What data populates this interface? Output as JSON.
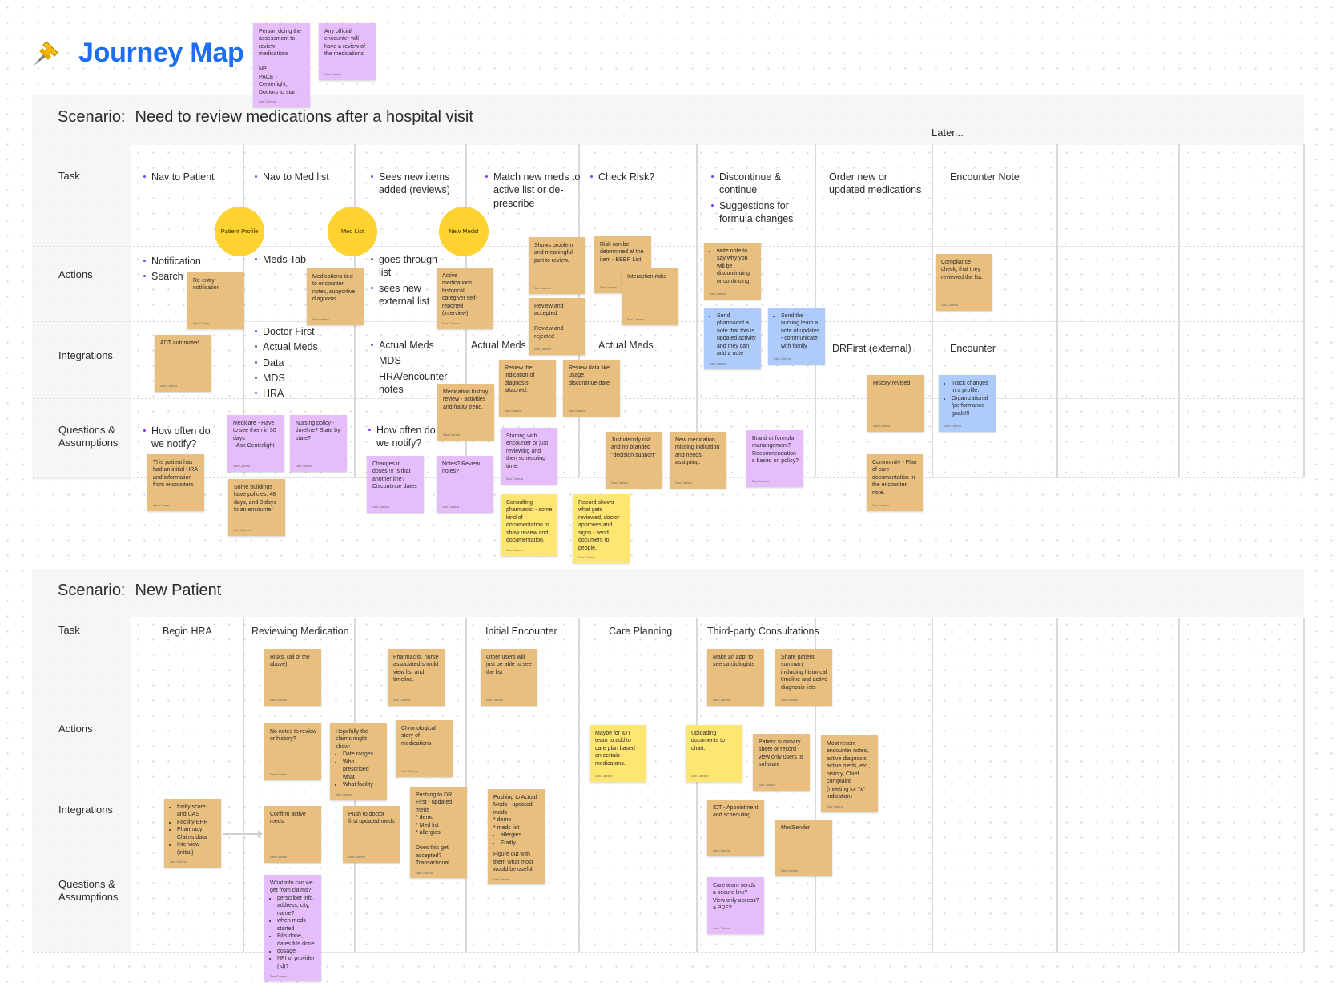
{
  "header": {
    "title": "Journey Map",
    "icon": "pushpin-icon",
    "notes": [
      {
        "color": "violet",
        "text": "Person doing the assessment to review medications\n\nNP\nPACE - Centerlight, Doctors to start",
        "author": "Sam Cabrera"
      },
      {
        "color": "violet",
        "text": "Any official encounter will have a review of the medications",
        "author": "Sam Cabrera"
      }
    ]
  },
  "row_labels": [
    "Task",
    "Actions",
    "Integrations",
    "Questions & Assumptions"
  ],
  "scenario1": {
    "label": "Scenario:",
    "title": "Need to review medications after a hospital visit",
    "later_label": "Later...",
    "tasks": [
      {
        "bullets": [
          "Nav to Patient"
        ]
      },
      {
        "bullets": [
          "Nav to Med list"
        ]
      },
      {
        "bullets": [
          "Sees new items added (reviews)"
        ]
      },
      {
        "bullets": [
          "Match new meds to active list or de-prescribe"
        ]
      },
      {
        "bullets": [
          "Check Risk?"
        ]
      },
      {
        "bullets": [
          "Discontinue & continue",
          "Suggestions for formula changes"
        ]
      },
      {
        "text": "Order new or updated medications"
      },
      {
        "text": "Encounter Note"
      }
    ],
    "circles": [
      "Patient Profile",
      "Med List",
      "New Meds!"
    ],
    "actions_text": [
      {
        "bullets": [
          "Notification",
          "Search"
        ]
      },
      {
        "bullets": [
          "Meds Tab"
        ]
      },
      {
        "bullets": [
          "goes through list",
          "sees new external list"
        ]
      }
    ],
    "integrations_text": [
      {
        "bullets": [
          "Doctor First",
          "Actual Meds",
          "Data",
          "MDS",
          "HRA"
        ]
      },
      {
        "bullets": [
          "Actual Meds"
        ],
        "extra": [
          "MDS",
          "HRA/encounter notes"
        ]
      },
      {
        "text": "Actual Meds"
      },
      {
        "text": "Actual Meds"
      },
      {
        "text": "DRFirst (external)"
      },
      {
        "text": "Encounter"
      }
    ],
    "questions_text": [
      {
        "bullets": [
          "How often do we notify?"
        ]
      },
      {
        "bullets": [
          "How often do we notify?"
        ]
      }
    ],
    "stickies": [
      {
        "color": "orange",
        "text": "Re-entry notification",
        "author": "Sam Cabrera"
      },
      {
        "color": "orange",
        "text": "Medications tied to encounter notes, supportive diagnosis",
        "author": "Sam Cabrera"
      },
      {
        "color": "orange",
        "text": "Active medications, historical, caregiver self-reported (interview)",
        "author": "Sam Cabrera"
      },
      {
        "color": "orange",
        "text": "Shows problem and meaningful part to review.",
        "author": "Sam Cabrera"
      },
      {
        "color": "orange",
        "text": "Risk can be determined at the item - BEER List",
        "author": "Sam Cabrera"
      },
      {
        "color": "orange",
        "text": "Interaction risks",
        "author": "Sam Cabrera"
      },
      {
        "color": "orange",
        "text": "Review and accepted\n\nReview and rejected",
        "author": "Sam Cabrera"
      },
      {
        "color": "orange",
        "list": [
          "write note to say why you will be discontinuing or continuing"
        ],
        "author": "Sam Cabrera"
      },
      {
        "color": "orange",
        "text": "Compliance check, that they reviewed the list.",
        "author": "Sam Cabrera"
      },
      {
        "color": "blue",
        "list": [
          "Send pharmacist a note that this is updated activity and they can add a note"
        ],
        "author": "Sam Cabrera"
      },
      {
        "color": "blue",
        "list": [
          "Send the nursing team a note of updates - communicate with family"
        ],
        "author": "Sam Cabrera"
      },
      {
        "color": "orange",
        "text": "ADT automated",
        "author": "Sam Cabrera"
      },
      {
        "color": "orange",
        "text": "Review the indication of diagnosis attached.",
        "author": "Sam Cabrera"
      },
      {
        "color": "orange",
        "text": "Review data like usage, discontinue date",
        "author": "Sam Cabrera"
      },
      {
        "color": "orange",
        "text": "Medication history review - activities and frailty trend.",
        "author": "Sam Cabrera"
      },
      {
        "color": "orange",
        "text": "History revised",
        "author": "Sam Cabrera"
      },
      {
        "color": "blue",
        "list": [
          "Track changes in a profile.",
          "Organizational /performance goals!!!"
        ],
        "author": "Sam Cabrera"
      },
      {
        "color": "violet",
        "text": "Medicare - Have to see them in 30 days\n- Ask Centerlight",
        "author": "Sam Cabrera"
      },
      {
        "color": "violet",
        "text": "Nursing policy - timeline? State by state?",
        "author": "Sam Cabrera"
      },
      {
        "color": "orange",
        "text": "This patient has had an initial HRA and information from encounters",
        "author": "Sam Cabrera"
      },
      {
        "color": "orange",
        "text": "Some buildings have policies: 48 days, and 3 days to an encounter",
        "author": "Sam Cabrera"
      },
      {
        "color": "violet",
        "text": "Changes in doses!!!! Is that another line? Discontinue dates",
        "author": "Sam Cabrera"
      },
      {
        "color": "violet",
        "text": "Notes? Review notes?",
        "author": "Sam Cabrera"
      },
      {
        "color": "violet",
        "text": "Starting with encounter or just reviewing and then scheduling time.",
        "author": "Sam Cabrera"
      },
      {
        "color": "yellow",
        "text": "Consulting pharmacist - some kind of documentation to show review and documentation.",
        "author": "Sam Cabrera"
      },
      {
        "color": "yellow",
        "text": "Record shows what gets reviewed, doctor approves and signs - send document to people.",
        "author": "Sam Cabrera"
      },
      {
        "color": "orange",
        "text": "Just identify risk and no branded \"decision support\"",
        "author": "Sam Cabrera"
      },
      {
        "color": "orange",
        "text": "New medication, missing indication and needs assigning.",
        "author": "Sam Cabrera"
      },
      {
        "color": "violet",
        "text": "Brand or formula manangement? Recommendation s based on policy?",
        "author": "Sam Cabrera"
      },
      {
        "color": "orange",
        "text": "Community - Plan of care documentation in the encounter note.",
        "author": "Sam Cabrera"
      }
    ]
  },
  "scenario2": {
    "label": "Scenario:",
    "title": "New Patient",
    "tasks": [
      "Begin HRA",
      "Reviewing Medication",
      "",
      "Initial Encounter",
      "Care Planning",
      "Third-party Consultations"
    ],
    "stickies": [
      {
        "color": "orange",
        "text": "Risks, (all of the above)",
        "author": "Sam Cabrera"
      },
      {
        "color": "orange",
        "text": "Pharmacist, nurse associated should view list and timeline.",
        "author": "Sam Cabrera"
      },
      {
        "color": "orange",
        "text": "Other users will just be able to see the list",
        "author": "Sam Cabrera"
      },
      {
        "color": "orange",
        "text": "Make an appt to see cardiologists",
        "author": "Sam Cabrera"
      },
      {
        "color": "orange",
        "text": "Share patient summary including historical timeline and active diagnosis lists",
        "author": "Sam Cabrera"
      },
      {
        "color": "orange",
        "text": "No notes to review or history?",
        "author": "Sam Cabrera"
      },
      {
        "color": "orange",
        "text": "Hopefully the claims might show:",
        "list": [
          "Date ranges",
          "Who prescribed what",
          "What facility"
        ],
        "author": "Sam Cabrera"
      },
      {
        "color": "orange",
        "text": "Chronological story of medications",
        "author": "Sam Cabrera"
      },
      {
        "color": "yellow",
        "text": "Maybe for IDT team to add to care plan based on certain medicatons.",
        "author": "Sam Cabrera"
      },
      {
        "color": "yellow",
        "text": "Uploading documents to chart.",
        "author": "Sam Cabrera"
      },
      {
        "color": "orange",
        "text": "Patient summary sheet or record - view only users to software",
        "author": "Sam Cabrera"
      },
      {
        "color": "orange",
        "text": "Most recent encounter notes, active diagnosis, active meds, etc., history, Chief complaint (meeting for \"x\" indication)",
        "author": "Sam Cabrera"
      },
      {
        "color": "orange",
        "list": [
          "frailty score and UAS",
          "Facility EHR",
          "Pharmacy Claims data",
          "Interview (initial)"
        ],
        "author": "Sam Cabrera"
      },
      {
        "color": "orange",
        "text": "Confirm active meds",
        "author": "Sam Cabrera"
      },
      {
        "color": "orange",
        "text": "Push to doctor first updated meds",
        "author": "Sam Cabrera"
      },
      {
        "color": "orange",
        "text": "Pushing to DR First - updated meds\n* demo\n* Med list\n* allergies\n\nDoes this get accepted? Transactional",
        "author": "Sam Cabrera"
      },
      {
        "color": "orange",
        "text": "Pushing to Actual Meds - updated meds\n* demo\n* meds list",
        "list": [
          "allergies",
          "Frailty"
        ],
        "text2": "Figure out with them what most would be useful",
        "author": "Sam Cabrera"
      },
      {
        "color": "orange",
        "text": "IDT - Appointment and scheduling",
        "author": "Sam Cabrera"
      },
      {
        "color": "orange",
        "text": "MedSender",
        "author": "Sam Cabrera"
      },
      {
        "color": "violet",
        "text": "What info can we get from claims?",
        "list": [
          "perscriber info, address, city, name?",
          "when meds started",
          "Fills done, dates fills done",
          "dosage",
          "NPI of provider (Id)?"
        ],
        "author": "Sam Cabrera"
      },
      {
        "color": "violet",
        "text": "Care team sends a secure link? View only access? a PDF?",
        "author": "Sam Cabrera"
      }
    ]
  }
}
